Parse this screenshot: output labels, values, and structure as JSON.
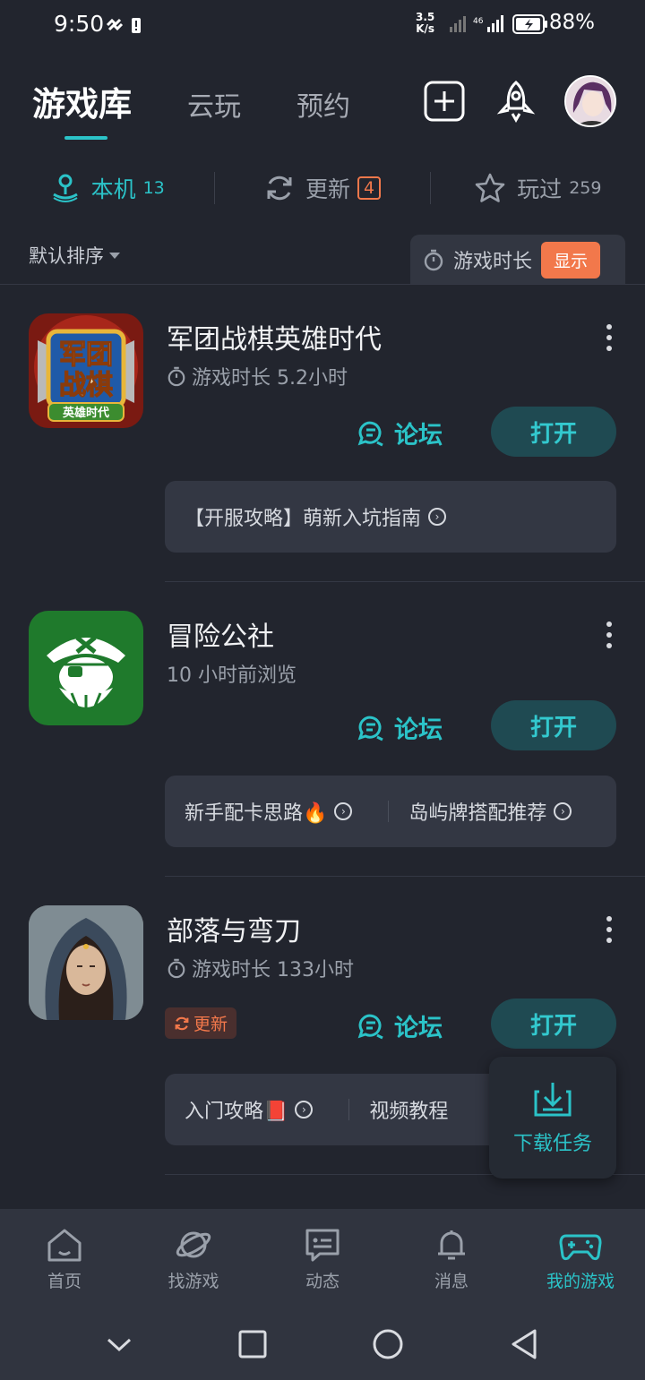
{
  "status_bar": {
    "time": "9:50",
    "net_speed_value": "3.5",
    "net_speed_unit": "K/s",
    "battery": "88%"
  },
  "header": {
    "tabs": [
      {
        "label": "游戏库",
        "active": true
      },
      {
        "label": "云玩",
        "active": false
      },
      {
        "label": "预约",
        "active": false
      }
    ],
    "icons": [
      "add-icon",
      "rocket-icon"
    ]
  },
  "filters": [
    {
      "label": "本机",
      "count": "13",
      "icon": "joystick-icon",
      "active": true
    },
    {
      "label": "更新",
      "count": "4",
      "icon": "refresh-icon",
      "active": false
    },
    {
      "label": "玩过",
      "count": "259",
      "icon": "star-icon",
      "active": false
    }
  ],
  "sort": {
    "label": "默认排序",
    "time_toggle_label": "游戏时长",
    "time_toggle_button": "显示"
  },
  "games": [
    {
      "name": "军团战棋英雄时代",
      "subtitle": "游戏时长 5.2小时",
      "forum_label": "论坛",
      "open_label": "打开",
      "icon_text_top": "军团",
      "icon_text_mid": "战棋",
      "icon_text_bottom": "英雄时代",
      "guides": [
        "【开服攻略】萌新入坑指南"
      ]
    },
    {
      "name": "冒险公社",
      "subtitle": "10 小时前浏览",
      "forum_label": "论坛",
      "open_label": "打开",
      "guides": [
        "新手配卡思路🔥",
        "岛屿牌搭配推荐"
      ]
    },
    {
      "name": "部落与弯刀",
      "subtitle": "游戏时长 133小时",
      "update_tag": "更新",
      "forum_label": "论坛",
      "open_label": "打开",
      "guides": [
        "入门攻略📕",
        "视频教程"
      ]
    }
  ],
  "download_float": {
    "label": "下载任务"
  },
  "bottom_nav": [
    {
      "label": "首页",
      "icon": "home-icon",
      "active": false
    },
    {
      "label": "找游戏",
      "icon": "planet-icon",
      "active": false
    },
    {
      "label": "动态",
      "icon": "message-icon",
      "active": false
    },
    {
      "label": "消息",
      "icon": "bell-icon",
      "active": false
    },
    {
      "label": "我的游戏",
      "icon": "gamepad-icon",
      "active": true
    }
  ],
  "colors": {
    "background": "#22252e",
    "accent": "#2bc3c8",
    "warning": "#f2784b",
    "card": "#333743"
  }
}
